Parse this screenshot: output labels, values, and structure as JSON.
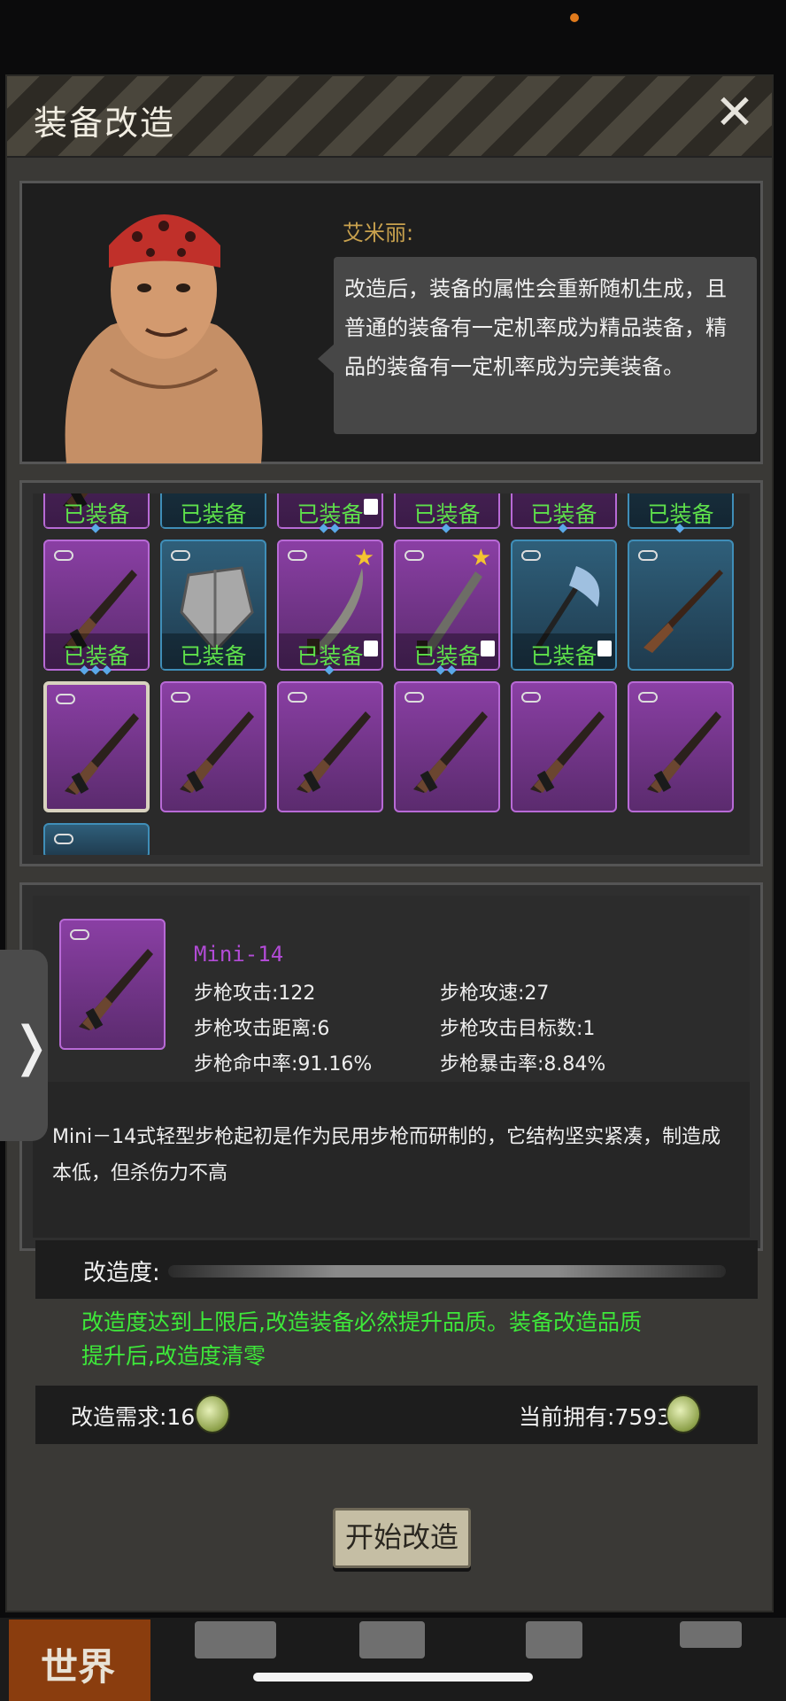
{
  "window": {
    "title": "装备改造",
    "close_glyph": "✕"
  },
  "npc": {
    "name": "艾米丽:",
    "speech": "改造后，装备的属性会重新随机生成，且普通的装备有一定机率成为精品装备，精品的装备有一定机率成为完美装备。"
  },
  "grid": {
    "equipped_label": "已装备",
    "rows": [
      [
        {
          "rarity": "purple",
          "equipped": true,
          "gems": "◆",
          "lock": false,
          "star": false,
          "item": "rifle-icon"
        },
        {
          "rarity": "blue",
          "equipped": true,
          "gems": "",
          "lock": false,
          "star": false,
          "item": "unknown-icon"
        },
        {
          "rarity": "purple",
          "equipped": true,
          "gems": "◆◆",
          "lock": true,
          "star": false,
          "item": "unknown-icon"
        },
        {
          "rarity": "purple",
          "equipped": true,
          "gems": "◆",
          "lock": false,
          "star": false,
          "item": "unknown-icon"
        },
        {
          "rarity": "purple",
          "equipped": true,
          "gems": "◆",
          "lock": false,
          "star": false,
          "item": "unknown-icon"
        },
        {
          "rarity": "blue",
          "equipped": true,
          "gems": "◆",
          "lock": false,
          "star": false,
          "item": "unknown-icon"
        }
      ],
      [
        {
          "rarity": "purple",
          "equipped": true,
          "gems": "◆◆◆",
          "lock": false,
          "star": false,
          "item": "rifle-icon"
        },
        {
          "rarity": "blue",
          "equipped": true,
          "gems": "",
          "lock": false,
          "star": false,
          "item": "shield-icon"
        },
        {
          "rarity": "purple",
          "equipped": true,
          "gems": "◆",
          "lock": true,
          "star": true,
          "item": "machete-icon"
        },
        {
          "rarity": "purple",
          "equipped": true,
          "gems": "◆◆",
          "lock": true,
          "star": true,
          "item": "blade-icon"
        },
        {
          "rarity": "blue",
          "equipped": true,
          "gems": "",
          "lock": true,
          "star": false,
          "item": "axe-icon"
        },
        {
          "rarity": "blue",
          "equipped": false,
          "gems": "",
          "lock": false,
          "star": false,
          "item": "shotgun-icon"
        }
      ],
      [
        {
          "rarity": "purple",
          "equipped": false,
          "gems": "",
          "lock": false,
          "star": false,
          "item": "rifle-icon",
          "selected": true
        },
        {
          "rarity": "purple",
          "equipped": false,
          "gems": "",
          "lock": false,
          "star": false,
          "item": "rifle-icon"
        },
        {
          "rarity": "purple",
          "equipped": false,
          "gems": "",
          "lock": false,
          "star": false,
          "item": "rifle-icon"
        },
        {
          "rarity": "purple",
          "equipped": false,
          "gems": "",
          "lock": false,
          "star": false,
          "item": "rifle-icon"
        },
        {
          "rarity": "purple",
          "equipped": false,
          "gems": "",
          "lock": false,
          "star": false,
          "item": "rifle-icon"
        },
        {
          "rarity": "purple",
          "equipped": false,
          "gems": "",
          "lock": false,
          "star": false,
          "item": "rifle-icon"
        }
      ]
    ]
  },
  "detail": {
    "name": "Mini-14",
    "stats": {
      "attack": "步枪攻击:122",
      "speed": "步枪攻速:27",
      "range": "步枪攻击距离:6",
      "targets": "步枪攻击目标数:1",
      "accuracy": "步枪命中率:91.16%",
      "crit": "步枪暴击率:8.84%"
    },
    "description": "Mini－14式轻型步枪起初是作为民用步枪而研制的，它结构坚实紧凑，制造成本低，但杀伤力不高"
  },
  "modification": {
    "label": "改造度:",
    "progress": 0,
    "note": "改造度达到上限后,改造装备必然提升品质。装备改造品质提升后,改造度清零",
    "requirement": "改造需求:16",
    "owned": "当前拥有:7593"
  },
  "start_button": "开始改造",
  "side_tab_arrow": "❭",
  "bottom_nav": {
    "world": "世界"
  },
  "colors": {
    "accent_green": "#3ee83a",
    "rarity_purple": "#b86ad6",
    "rarity_blue": "#3f8eb8",
    "item_name": "#b24bd6"
  }
}
